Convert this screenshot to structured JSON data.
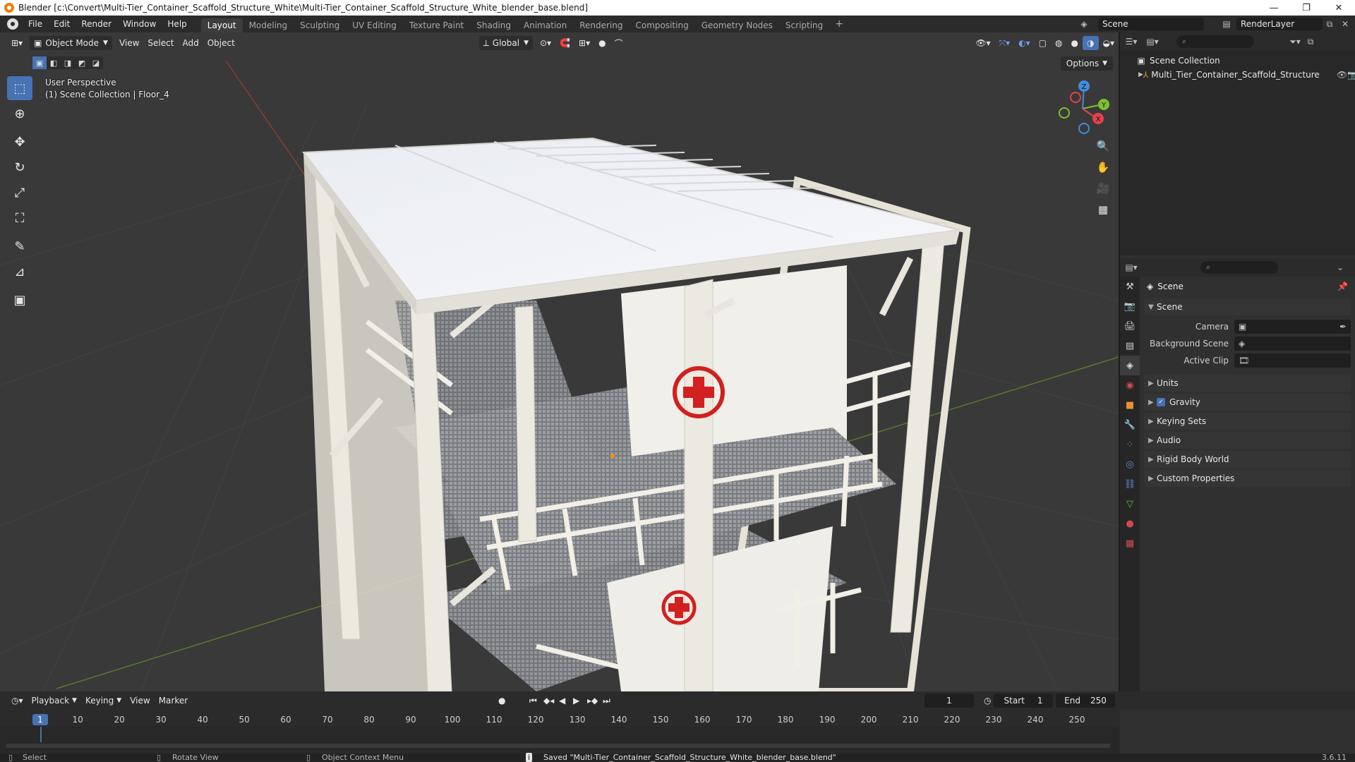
{
  "window": {
    "title": "Blender [c:\\Convert\\Multi-Tier_Container_Scaffold_Structure_White\\Multi-Tier_Container_Scaffold_Structure_White_blender_base.blend]",
    "minimize": "—",
    "maximize": "❐",
    "close": "✕"
  },
  "menus": [
    "File",
    "Edit",
    "Render",
    "Window",
    "Help"
  ],
  "workspaces": [
    "Layout",
    "Modeling",
    "Sculpting",
    "UV Editing",
    "Texture Paint",
    "Shading",
    "Animation",
    "Rendering",
    "Compositing",
    "Geometry Nodes",
    "Scripting"
  ],
  "active_workspace": "Layout",
  "workspace_add": "+",
  "scene_name": "Scene",
  "view_layer": "RenderLayer",
  "viewport": {
    "mode": "Object Mode",
    "menus": [
      "View",
      "Select",
      "Add",
      "Object"
    ],
    "transform_orientation": "Global",
    "options_label": "Options",
    "overlay_line1": "User Perspective",
    "overlay_line2": "(1) Scene Collection | Floor_4",
    "gizmo": {
      "z": "Z",
      "y": "Y",
      "x": "X"
    }
  },
  "tools": [
    {
      "name": "select-box-tool",
      "glyph": "⬚"
    },
    {
      "name": "cursor-tool",
      "glyph": "⊕"
    },
    {
      "name": "move-tool",
      "glyph": "✥"
    },
    {
      "name": "rotate-tool",
      "glyph": "↻"
    },
    {
      "name": "scale-tool",
      "glyph": "⤢"
    },
    {
      "name": "transform-tool",
      "glyph": "⛶"
    },
    {
      "name": "annotate-tool",
      "glyph": "✎"
    },
    {
      "name": "measure-tool",
      "glyph": "📐"
    },
    {
      "name": "add-cube-tool",
      "glyph": "▣"
    }
  ],
  "outliner": {
    "search_placeholder": "",
    "root": "Scene Collection",
    "items": [
      "Multi_Tier_Container_Scaffold_Structure"
    ]
  },
  "properties": {
    "context_title": "Scene",
    "scene_panel": "Scene",
    "camera_label": "Camera",
    "camera_value": "",
    "background_label": "Background Scene",
    "background_value": "",
    "active_clip_label": "Active Clip",
    "active_clip_value": "",
    "panels": [
      "Units",
      "Gravity",
      "Keying Sets",
      "Audio",
      "Rigid Body World",
      "Custom Properties"
    ],
    "gravity_checked": true
  },
  "timeline": {
    "menus": [
      "Playback",
      "Keying",
      "View",
      "Marker"
    ],
    "current_frame": "1",
    "start_label": "Start",
    "start_value": "1",
    "end_label": "End",
    "end_value": "250",
    "ticks": [
      "1",
      "10",
      "20",
      "30",
      "40",
      "50",
      "60",
      "70",
      "80",
      "90",
      "100",
      "110",
      "120",
      "130",
      "140",
      "150",
      "160",
      "170",
      "180",
      "190",
      "200",
      "210",
      "220",
      "230",
      "240",
      "250"
    ]
  },
  "statusbar": {
    "select": "Select",
    "rotate": "Rotate View",
    "context_menu": "Object Context Menu",
    "message": "Saved \"Multi-Tier_Container_Scaffold_Structure_White_blender_base.blend\"",
    "version": "3.6.11"
  },
  "colors": {
    "accent": "#4772b3",
    "x_axis": "#e2414f",
    "y_axis": "#7dbf34",
    "z_axis": "#3f8edc",
    "cross_red": "#d21f1f"
  }
}
